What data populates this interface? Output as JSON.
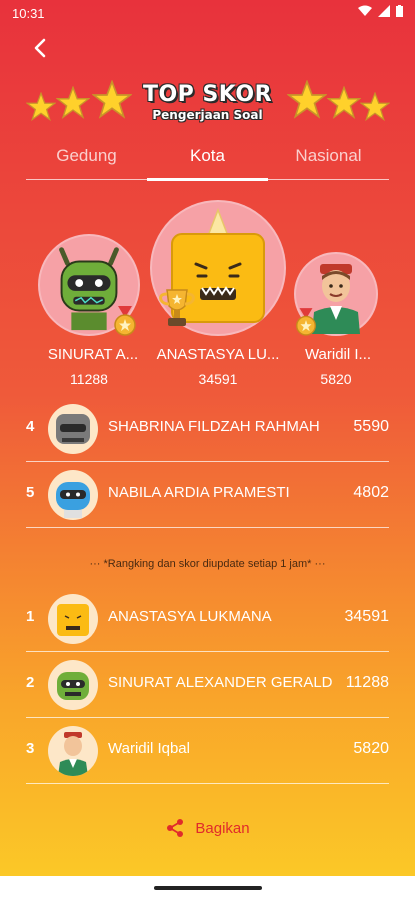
{
  "status": {
    "time": "10:31"
  },
  "header": {
    "title": "TOP SKOR",
    "subtitle": "Pengerjaan Soal"
  },
  "tabs": [
    {
      "label": "Gedung",
      "active": false
    },
    {
      "label": "Kota",
      "active": true
    },
    {
      "label": "Nasional",
      "active": false
    }
  ],
  "podium": [
    {
      "place": 2,
      "name": "SINURAT A...",
      "score": "11288"
    },
    {
      "place": 1,
      "name": "ANASTASYA LU...",
      "score": "34591"
    },
    {
      "place": 3,
      "name": "Waridil I...",
      "score": "5820"
    }
  ],
  "list_top": [
    {
      "rank": "4",
      "name": "SHABRINA FILDZAH RAHMAH",
      "score": "5590"
    },
    {
      "rank": "5",
      "name": "NABILA ARDIA PRAMESTI",
      "score": "4802"
    }
  ],
  "note": "··· *Rangking dan skor diupdate setiap 1 jam* ···",
  "list_city": [
    {
      "rank": "1",
      "name": "ANASTASYA LUKMANA",
      "score": "34591"
    },
    {
      "rank": "2",
      "name": "SINURAT ALEXANDER GERALD",
      "score": "11288"
    },
    {
      "rank": "3",
      "name": "Waridil Iqbal",
      "score": "5820"
    }
  ],
  "share": {
    "label": "Bagikan"
  },
  "colors": {
    "accent": "#e8323c",
    "gold": "#fbc827"
  }
}
